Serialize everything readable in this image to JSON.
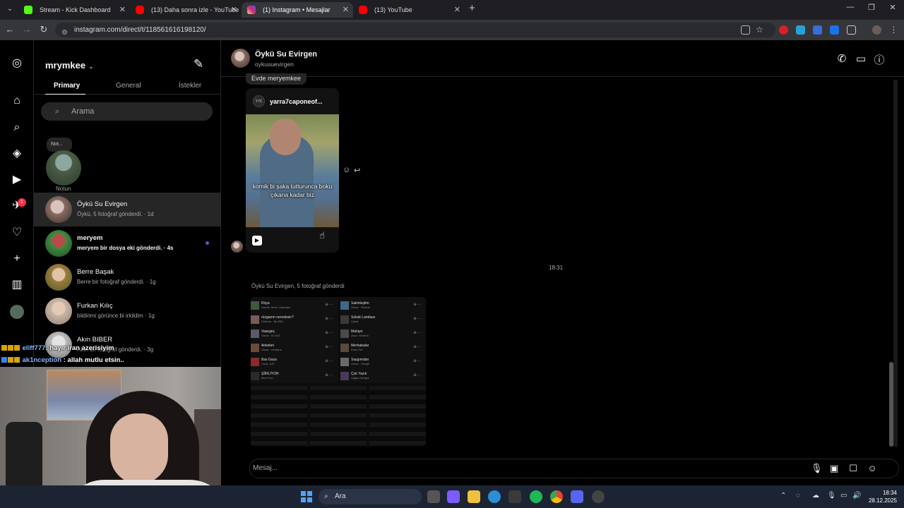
{
  "browser": {
    "tabs": [
      {
        "title": "Stream - Kick Dashboard",
        "favicon_color": "#53fc18"
      },
      {
        "title": "(13) Daha sonra izle - YouTube",
        "favicon_color": "#ff0000"
      },
      {
        "title": "(1) Instagram • Mesajlar",
        "favicon_color": "#d62976"
      },
      {
        "title": "(13) YouTube",
        "favicon_color": "#ff0000"
      }
    ],
    "url": "instagram.com/direct/t/118561616198120/"
  },
  "rail": {
    "notification_badge": "1",
    "icons": [
      "instagram-logo-icon",
      "home-icon",
      "search-icon",
      "explore-icon",
      "reels-icon",
      "messages-icon",
      "notifications-icon",
      "create-icon",
      "dashboard-icon",
      "profile-icon"
    ]
  },
  "dm_panel": {
    "username": "mrymkee",
    "tabs": [
      "Primary",
      "General",
      "İstekler"
    ],
    "search_placeholder": "Arama",
    "note": {
      "bubble": "Not...",
      "label": "Notun"
    },
    "conversations": [
      {
        "name": "Öykü Su Evirgen",
        "preview": "Öykü, 5 fotoğraf gönderdi. · 1d",
        "selected": true,
        "unread": false
      },
      {
        "name": "meryem",
        "preview": "meryem bir dosya eki gönderdi. · 4s",
        "selected": false,
        "unread": true
      },
      {
        "name": "Berre Başak",
        "preview": "Berre bir fotoğraf gönderdi. · 1g",
        "selected": false,
        "unread": false
      },
      {
        "name": "Furkan Kılıç",
        "preview": "bildirimi görünce bi irkildim · 1g",
        "selected": false,
        "unread": false
      },
      {
        "name": "Akın BIBER",
        "preview": "Akın bir fotoğraf gönderdi. · 3g",
        "selected": false,
        "unread": false
      }
    ]
  },
  "stream_chat": [
    {
      "user": "eliff777",
      "message": "hayır iran azerisiyim"
    },
    {
      "user": "ak1nception",
      "message": "allah mutlu etsin.."
    }
  ],
  "thread": {
    "name": "Öykü Su Evirgen",
    "username": "oykusuevirgen",
    "reply_pill": "Evde meryemkee",
    "reel": {
      "owner": "yarra7caponeof...",
      "owner_avatar_text": "Y7C",
      "caption": "komik bi şaka tutturunca boku çıkana kadar biz"
    },
    "timestamp": "18:31",
    "sent_label": "Öykü Su Evirgen, 5 fotoğraf gönderdi",
    "composer_placeholder": "Mesaj...",
    "playlist_left": [
      {
        "t1": "Rüya",
        "t2": "Hande Yener, Sokrates"
      },
      {
        "t1": "rüzgarım neredesin?",
        "t2": "Gökhan · BLOKE"
      },
      {
        "t1": "Vaazgeç",
        "t2": "Views · Ar·343"
      },
      {
        "t1": "Ankeleri",
        "t2": "Views · mertane"
      },
      {
        "t1": "Bas Gaza",
        "t2": "Ceza, AJX"
      },
      {
        "t1": "ŞİİRLİYOR",
        "t2": "Ben Fero"
      }
    ],
    "playlist_right": [
      {
        "t1": "Sakinleştim",
        "t2": "Views · Önlene"
      },
      {
        "t1": "Sokak Lambası",
        "t2": "Çakal"
      },
      {
        "t1": "Mahşer",
        "t2": "Zeyn, Semiha"
      },
      {
        "t1": "Merhabalar",
        "t2": "Emre Fel"
      },
      {
        "t1": "Saygımdan",
        "t2": "Views · Sevgili"
      },
      {
        "t1": "Çok Yazık",
        "t2": "Çağan Şengül"
      }
    ]
  },
  "taskbar": {
    "search_label": "Ara",
    "time": "18:34",
    "date": "28.12.2025"
  }
}
